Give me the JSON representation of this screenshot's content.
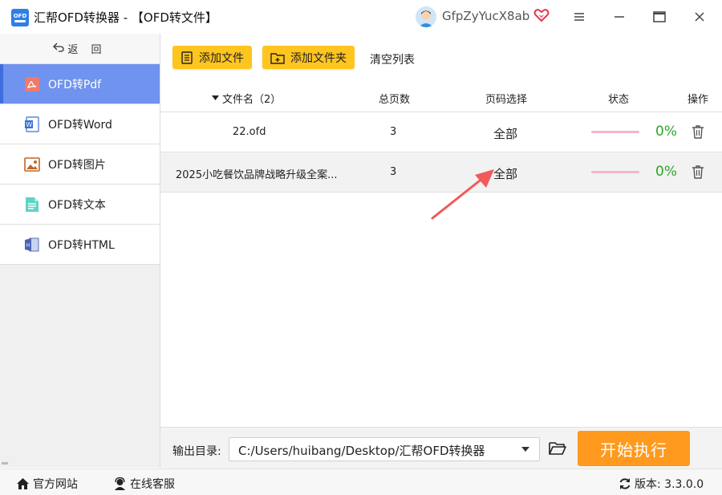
{
  "window": {
    "logo_text": "OFD",
    "title": "汇帮OFD转换器 - 【OFD转文件】",
    "username": "GfpZyYucX8ab"
  },
  "sidebar": {
    "back_label": "返 回",
    "items": [
      {
        "label": "OFD转Pdf",
        "icon": "pdf-icon",
        "active": true
      },
      {
        "label": "OFD转Word",
        "icon": "word-icon",
        "active": false
      },
      {
        "label": "OFD转图片",
        "icon": "image-icon",
        "active": false
      },
      {
        "label": "OFD转文本",
        "icon": "text-icon",
        "active": false
      },
      {
        "label": "OFD转HTML",
        "icon": "html-icon",
        "active": false
      }
    ]
  },
  "toolbar": {
    "add_file": "添加文件",
    "add_folder": "添加文件夹",
    "clear_list": "清空列表"
  },
  "table": {
    "headers": {
      "filename": "文件名（2）",
      "pages": "总页数",
      "range": "页码选择",
      "status": "状态",
      "action": "操作"
    },
    "rows": [
      {
        "filename": "22.ofd",
        "pages": "3",
        "range": "全部",
        "progress": 0,
        "percent": "0%"
      },
      {
        "filename": "2025小吃餐饮品牌战略升级全案...",
        "pages": "3",
        "range": "全部",
        "progress": 0,
        "percent": "0%"
      }
    ]
  },
  "output": {
    "label": "输出目录:",
    "path": "C:/Users/huibang/Desktop/汇帮OFD转换器",
    "start": "开始执行"
  },
  "statusbar": {
    "website": "官方网站",
    "support": "在线客服",
    "version": "版本: 3.3.0.0"
  },
  "colors": {
    "accent_blue": "#6f93ee",
    "button_yellow": "#ffc51f",
    "start_orange": "#ff9a1e",
    "percent_green": "#2aa52a",
    "annotation_arrow": "#f05a5a"
  }
}
